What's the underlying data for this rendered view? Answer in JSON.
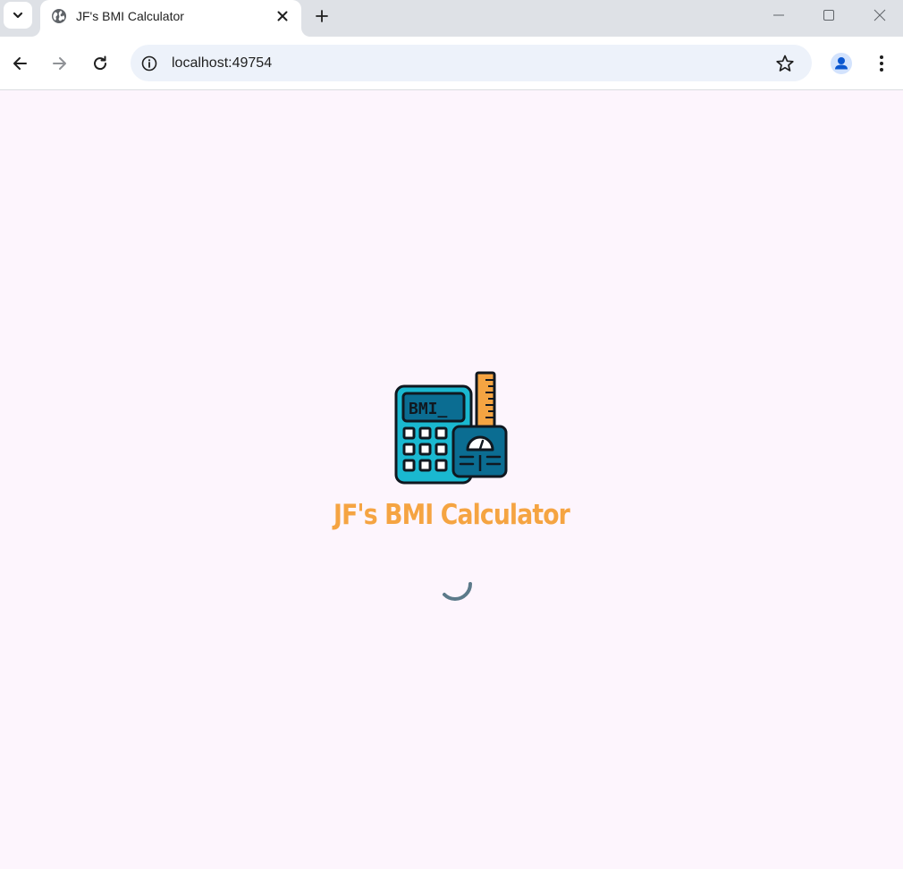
{
  "browser": {
    "tab": {
      "title": "JF's BMI Calculator"
    },
    "address_bar": {
      "url": "localhost:49754"
    }
  },
  "splash": {
    "logo_text": "BMI_",
    "title": "JF's BMI Calculator"
  },
  "colors": {
    "accent": "#f5a442",
    "page_background": "#fdf5fd",
    "spinner": "#5c7a8a",
    "calculator_body": "#1ab8d0",
    "scale_body": "#0b6d92",
    "ruler": "#f5a442"
  },
  "icons": {
    "tab_search": "chevron-down-icon",
    "favicon": "globe-icon",
    "tab_close": "close-icon",
    "new_tab": "plus-icon",
    "back": "arrow-left-icon",
    "forward": "arrow-right-icon",
    "reload": "reload-icon",
    "site_info": "info-icon",
    "bookmark": "star-icon",
    "profile": "person-icon",
    "menu": "kebab-menu-icon"
  }
}
